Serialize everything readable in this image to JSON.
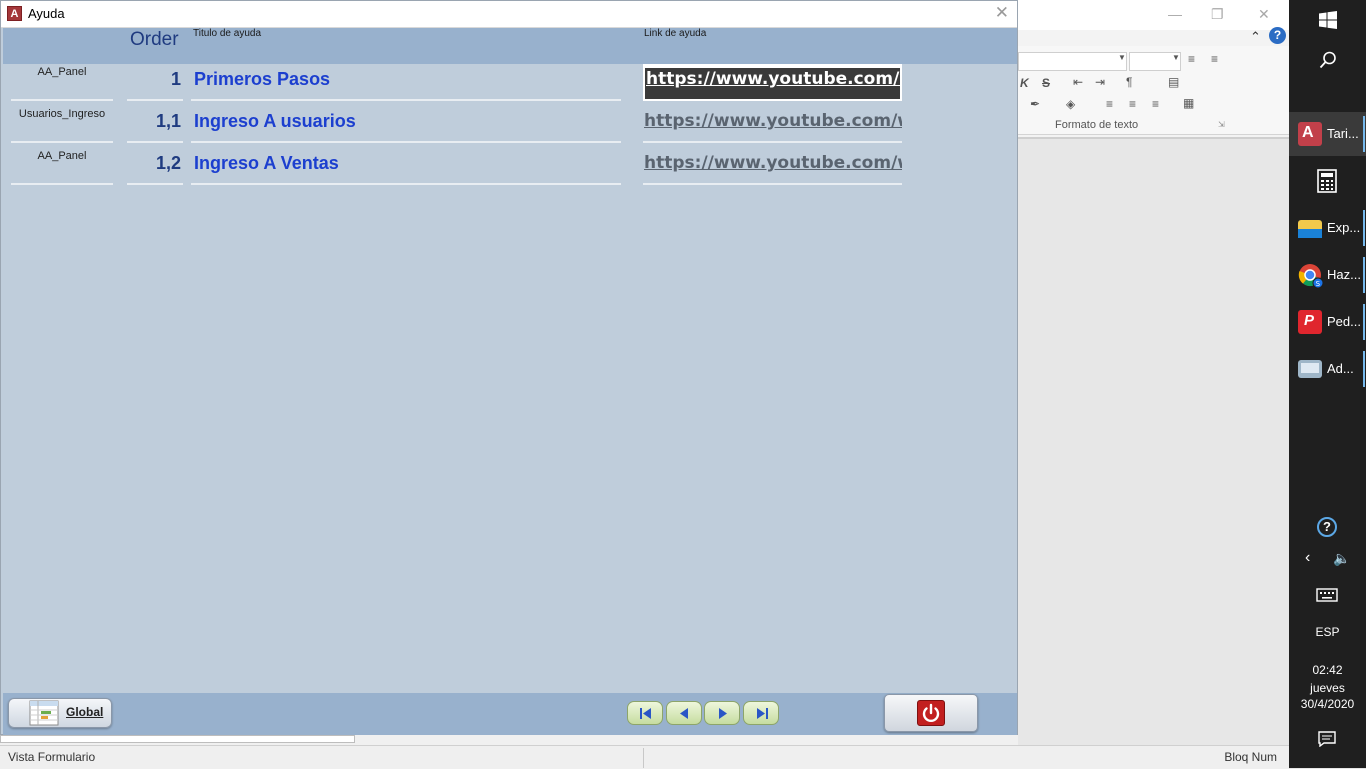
{
  "dialog": {
    "title": "Ayuda",
    "app_icon_letter": "A",
    "header": {
      "order_label": "Order",
      "title_label": "Titulo de ayuda",
      "link_label": "Link de ayuda"
    },
    "records": [
      {
        "category": "AA_Panel",
        "order": "1",
        "title": "Primeros Pasos",
        "link": "https://www.youtube.com/watch"
      },
      {
        "category": "Usuarios_Ingreso",
        "order": "1,1",
        "title": "Ingreso A usuarios",
        "link": "https://www.youtube.com/watch"
      },
      {
        "category": "AA_Panel",
        "order": "1,2",
        "title": "Ingreso A Ventas",
        "link": "https://www.youtube.com/watch"
      }
    ],
    "footer": {
      "global_label": "Global"
    }
  },
  "background_app": {
    "group_label": "Formato de texto"
  },
  "statusbar": {
    "left": "Vista Formulario",
    "right": "Bloq Num"
  },
  "taskbar": {
    "items": [
      {
        "label": "Tari...",
        "icon": "access-icon"
      },
      {
        "label": "",
        "icon": "calculator-icon"
      },
      {
        "label": "Exp...",
        "icon": "file-explorer-icon"
      },
      {
        "label": "Haz...",
        "icon": "chrome-icon"
      },
      {
        "label": "Ped...",
        "icon": "pdf-icon"
      },
      {
        "label": "Ad...",
        "icon": "monitor-icon"
      }
    ],
    "language": "ESP",
    "time": "02:42",
    "day": "jueves",
    "date": "30/4/2020"
  }
}
